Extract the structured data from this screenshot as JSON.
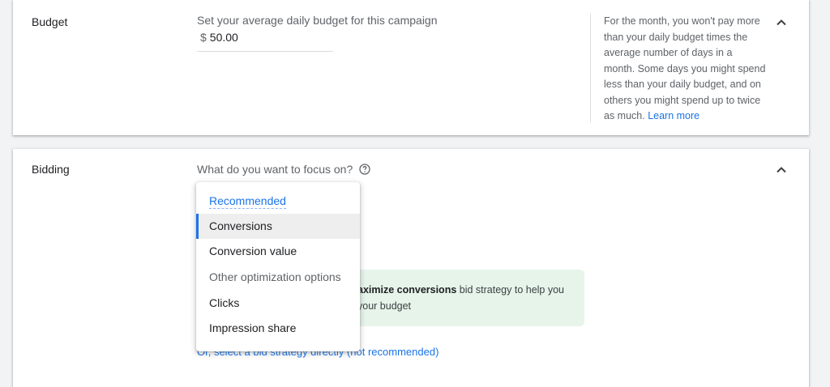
{
  "budget": {
    "title": "Budget",
    "label": "Set your average daily budget for this campaign",
    "currency_symbol": "$",
    "value": "50.00",
    "help_text": "For the month, you won't pay more than your daily budget times the average number of days in a month. Some days you might spend less than your daily budget, and on others you might spend up to twice as much.",
    "learn_more": "Learn more"
  },
  "bidding": {
    "title": "Bidding",
    "question": "What do you want to focus on?",
    "info_line1_bold": "aximize conversions",
    "info_line1_rest": " bid strategy to help you",
    "info_line2": "your budget",
    "bid_strategy_link": "Or, select a bid strategy directly (not recommended)"
  },
  "dropdown": {
    "recommended_header": "Recommended",
    "items": [
      {
        "label": "Conversions"
      },
      {
        "label": "Conversion value"
      },
      {
        "label": "Other optimization options"
      },
      {
        "label": "Clicks"
      },
      {
        "label": "Impression share"
      }
    ],
    "selected": "Conversions"
  },
  "colors": {
    "accent": "#1a73e8",
    "info_bg": "#e6f4ea",
    "selected_bg": "#eeeeee"
  },
  "icons": {
    "collapse": "chevron-up-icon",
    "help": "help-circle-icon"
  }
}
